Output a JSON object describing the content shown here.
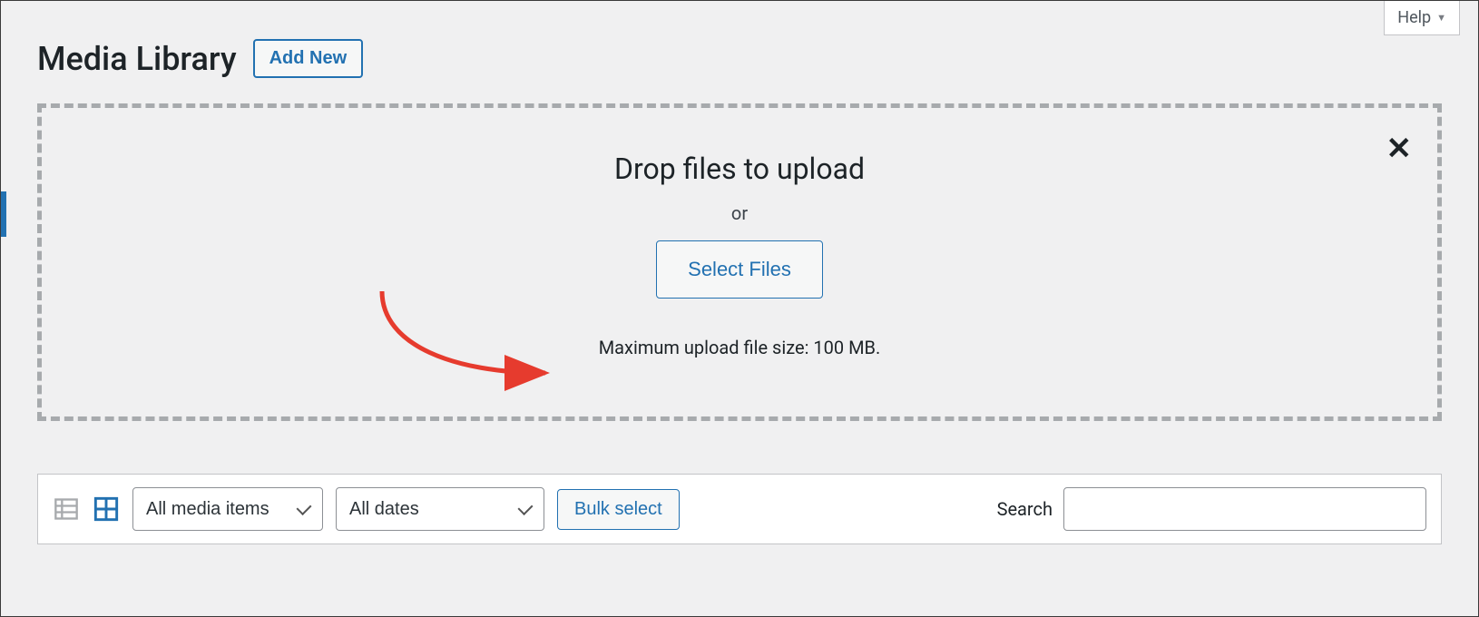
{
  "help": {
    "label": "Help"
  },
  "header": {
    "title": "Media Library",
    "add_new_label": "Add New"
  },
  "dropzone": {
    "title": "Drop files to upload",
    "or": "or",
    "select_files_label": "Select Files",
    "max_upload_text": "Maximum upload file size: 100 MB."
  },
  "filters": {
    "media_items_selected": "All media items",
    "dates_selected": "All dates",
    "bulk_select_label": "Bulk select",
    "search_label": "Search",
    "search_value": ""
  }
}
